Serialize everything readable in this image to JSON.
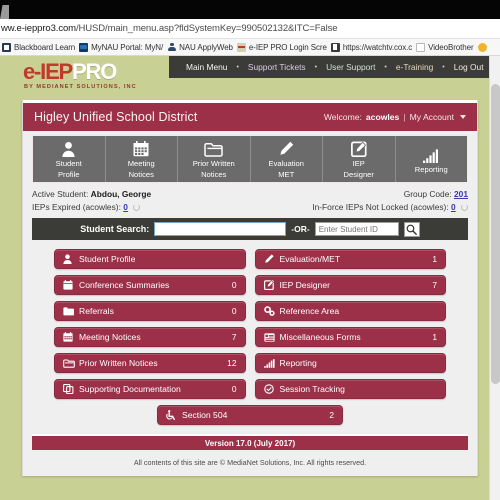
{
  "browser": {
    "url_prefix": "ww.e-ieppro3.com",
    "url_suffix": "/HUSD/main_menu.asp?fldSystemKey=990502132&ITC=False",
    "bookmarks": [
      {
        "label": "Blackboard Learn",
        "icon": "blackboard-favicon"
      },
      {
        "label": "MyNAU Portal: MyN/",
        "icon": "mynau-favicon"
      },
      {
        "label": "NAU ApplyWeb",
        "icon": "person-favicon"
      },
      {
        "label": "e-IEP PRO Login Scre",
        "icon": "eieppro-favicon"
      },
      {
        "label": "https://watchtv.cox.c",
        "icon": "generic-e-favicon"
      },
      {
        "label": "VideoBrother",
        "icon": "document-favicon"
      }
    ]
  },
  "brand": {
    "logo_e": "e-",
    "logo_iep": "IEP",
    "logo_pro": "PRO",
    "tagline": "BY MEDIANET SOLUTIONS, INC"
  },
  "topnav": {
    "items": [
      {
        "label": "Main Menu"
      },
      {
        "label": "Support Tickets"
      },
      {
        "label": "User Support"
      },
      {
        "label": "e-Training"
      },
      {
        "label": "Log Out"
      }
    ],
    "separator": "•"
  },
  "district": {
    "name": "Higley Unified School District",
    "welcome_label": "Welcome:",
    "username": "acowles",
    "divider": "|",
    "account_label": "My Account"
  },
  "icon_tabs": [
    {
      "label_1": "Student",
      "label_2": "Profile",
      "icon": "person-icon"
    },
    {
      "label_1": "Meeting",
      "label_2": "Notices",
      "icon": "calendar-icon"
    },
    {
      "label_1": "Prior Written",
      "label_2": "Notices",
      "icon": "open-folder-icon"
    },
    {
      "label_1": "Evaluation",
      "label_2": "MET",
      "icon": "pencil-icon"
    },
    {
      "label_1": "IEP",
      "label_2": "Designer",
      "icon": "edit-square-icon"
    },
    {
      "label_1": "Reporting",
      "label_2": "",
      "icon": "bar-chart-icon"
    }
  ],
  "student_info": {
    "active_student_label": "Active Student:",
    "active_student_name": "Abdou, George",
    "group_code_label": "Group Code:",
    "group_code_value": "201",
    "ieps_expired_label": "IEPs Expired (acowles):",
    "ieps_expired_value": "0",
    "not_locked_label": "In-Force IEPs Not Locked (acowles):",
    "not_locked_value": "0"
  },
  "search": {
    "label": "Student Search:",
    "main_value": "",
    "main_placeholder": "",
    "or_label": "-OR-",
    "student_id_value": "",
    "student_id_placeholder": "Enter Student ID",
    "go_icon": "search-icon"
  },
  "menu": {
    "left": [
      {
        "label": "Student Profile",
        "count": "",
        "icon": "person-icon"
      },
      {
        "label": "Conference Summaries",
        "count": "0",
        "icon": "calendar-icon"
      },
      {
        "label": "Referrals",
        "count": "0",
        "icon": "folder-icon"
      },
      {
        "label": "Meeting Notices",
        "count": "7",
        "icon": "calendar-grid-icon"
      },
      {
        "label": "Prior Written Notices",
        "count": "12",
        "icon": "open-folder-icon"
      },
      {
        "label": "Supporting Documentation",
        "count": "0",
        "icon": "copy-icon"
      }
    ],
    "right": [
      {
        "label": "Evaluation/MET",
        "count": "1",
        "icon": "pencil-icon"
      },
      {
        "label": "IEP Designer",
        "count": "7",
        "icon": "edit-square-icon"
      },
      {
        "label": "Reference Area",
        "count": "",
        "icon": "gears-icon"
      },
      {
        "label": "Miscellaneous Forms",
        "count": "1",
        "icon": "list-form-icon"
      },
      {
        "label": "Reporting",
        "count": "",
        "icon": "bar-chart-icon"
      },
      {
        "label": "Session Tracking",
        "count": "",
        "icon": "clock-check-icon"
      }
    ],
    "section504": {
      "label": "Section 504",
      "count": "2",
      "icon": "accessibility-icon"
    }
  },
  "footer": {
    "version": "Version 17.0 (July 2017)",
    "copyright": "All contents of this site are © MediaNet Solutions, Inc. All rights reserved."
  },
  "colors": {
    "brand_red": "#9c3048",
    "page_bg": "#c9d094",
    "dark_bar": "#3b3b38",
    "tab_gray": "#6b6b6b",
    "link_blue": "#3a36b0"
  }
}
